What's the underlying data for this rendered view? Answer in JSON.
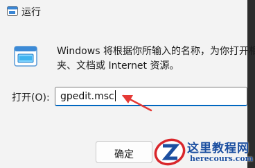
{
  "window": {
    "title": "运行",
    "description_line1": "Windows 将根据你所输入的名称，为你打开相",
    "description_line2": "夹、文档或 Internet 资源。"
  },
  "open_field": {
    "label": "打开(O):",
    "value": "gpedit.msc"
  },
  "buttons": {
    "ok_label": "确定"
  },
  "watermark": {
    "title": "这里教程网",
    "url": "herecours.com"
  },
  "colors": {
    "accent": "#0067c0",
    "annotation_arrow": "#e53935",
    "watermark_blue": "#1c4fa0",
    "watermark_red": "#d9262b"
  },
  "icons": {
    "app": "run-app-icon",
    "dialog": "run-dialog-icon",
    "annotation": "red-arrow-icon",
    "watermark": "watermark-logo-icon"
  }
}
